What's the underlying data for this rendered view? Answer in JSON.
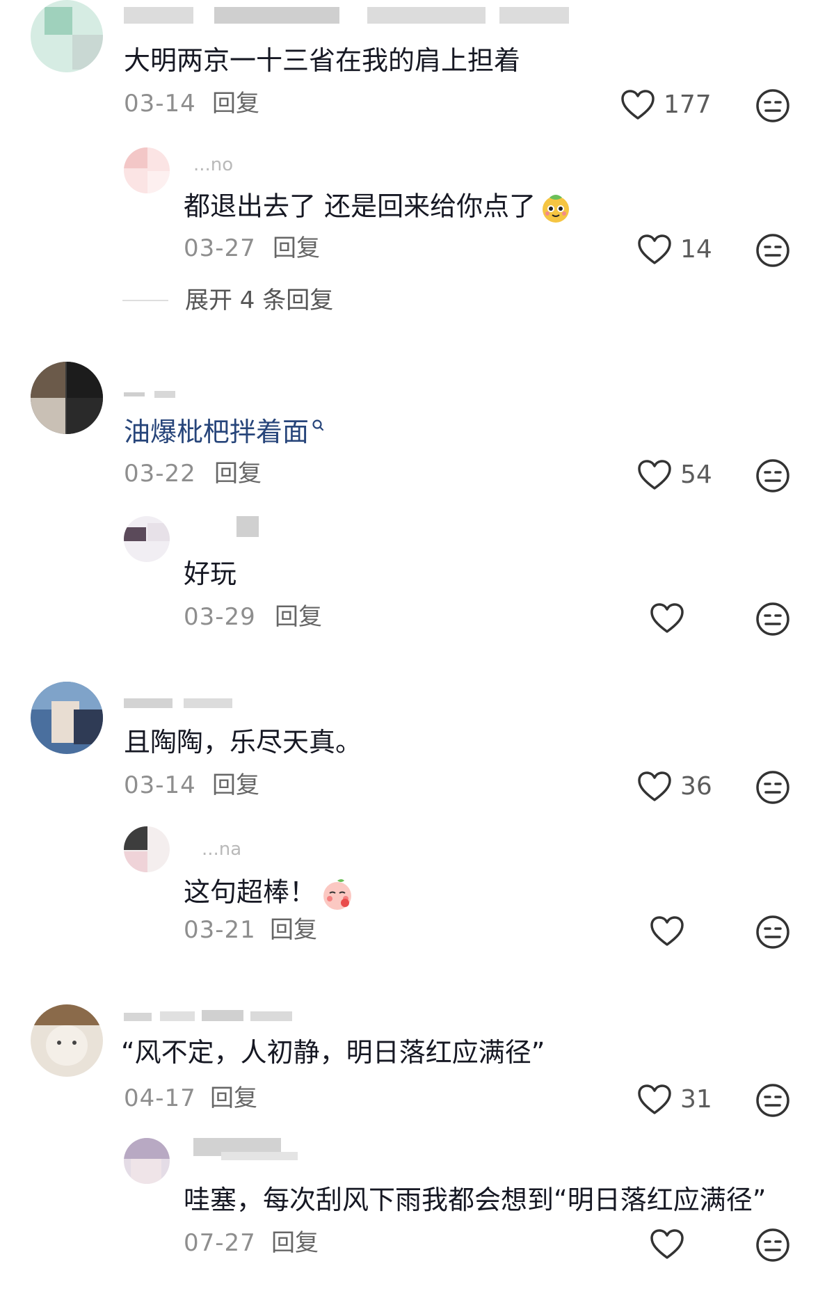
{
  "comments": [
    {
      "username": "",
      "text": "大明两京一十三省在我的肩上担着",
      "date": "03-14",
      "reply_label": "回复",
      "likes": "177",
      "replies": [
        {
          "username": "...no",
          "text": "都退出去了 还是回来给你点了",
          "emoji": "pudding-emoji",
          "date": "03-27",
          "reply_label": "回复",
          "likes": "14"
        }
      ],
      "expand_label": "展开 4 条回复"
    },
    {
      "username": "",
      "text": "油爆枇杷拌着面",
      "text_is_search_link": true,
      "date": "03-22",
      "reply_label": "回复",
      "likes": "54",
      "replies": [
        {
          "username": "",
          "text": "好玩",
          "date": "03-29",
          "reply_label": "回复",
          "likes": ""
        }
      ]
    },
    {
      "username": "",
      "text": "且陶陶，乐尽天真。",
      "date": "03-14",
      "reply_label": "回复",
      "likes": "36",
      "replies": [
        {
          "username": "...na",
          "text": "这句超棒！",
          "emoji": "blushing-peach-emoji",
          "date": "03-21",
          "reply_label": "回复",
          "likes": ""
        }
      ]
    },
    {
      "username": "",
      "text": "“风不定，人初静，明日落红应满径”",
      "date": "04-17",
      "reply_label": "回复",
      "likes": "31",
      "replies": [
        {
          "username": "",
          "text": "哇塞，每次刮风下雨我都会想到“明日落红应满径”",
          "date": "07-27",
          "reply_label": "回复",
          "likes": ""
        }
      ]
    }
  ],
  "icons": {
    "like": "heart-outline-icon",
    "react": "neutral-face-icon",
    "search_hint": "search-icon"
  },
  "colors": {
    "text": "#161823",
    "muted": "#8e8e8e",
    "link": "#27457a",
    "divider": "#dedede"
  }
}
